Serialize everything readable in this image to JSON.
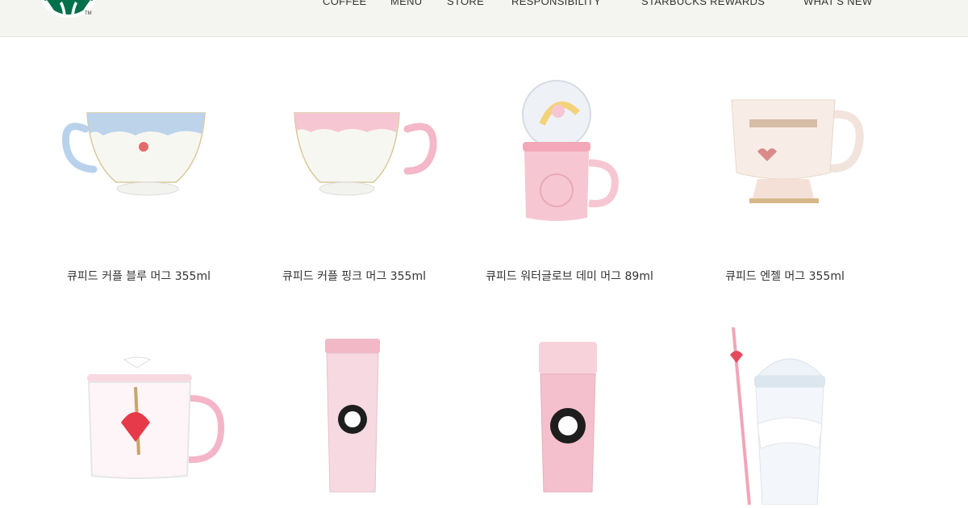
{
  "nav": {
    "items": [
      "COFFEE",
      "MENU",
      "STORE",
      "RESPONSIBILITY",
      "STARBUCKS REWARDS",
      "WHAT'S NEW"
    ]
  },
  "logo": {
    "tm": "TM"
  },
  "products": [
    {
      "name": "큐피드 커플 블루 머그 355ml"
    },
    {
      "name": "큐피드 커플 핑크 머그 355ml"
    },
    {
      "name": "큐피드 워터글로브 데미 머그 89ml"
    },
    {
      "name": "큐피드 엔젤 머그 355ml"
    },
    {
      "name": ""
    },
    {
      "name": ""
    },
    {
      "name": ""
    },
    {
      "name": ""
    }
  ],
  "colors": {
    "header_bg": "#f4f4f1",
    "brand_green": "#00704a",
    "pink": "#f4b8c8",
    "light_blue": "#bcd3ea"
  }
}
